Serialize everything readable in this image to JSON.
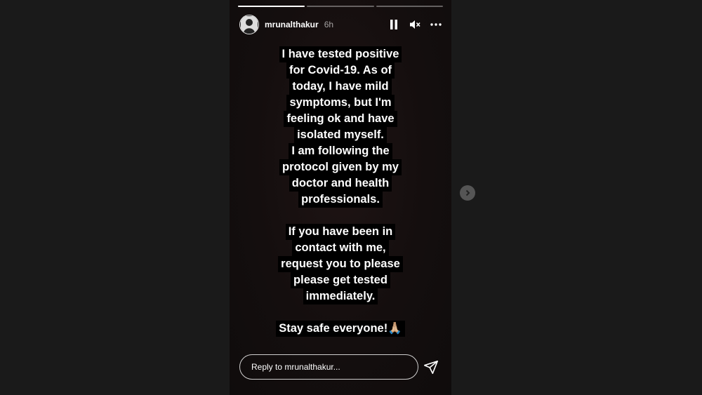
{
  "story": {
    "progress": [
      1,
      0,
      0
    ],
    "user": {
      "username": "mrunalthakur",
      "time": "6h",
      "avatar_icon": "avatar-icon"
    },
    "controls": {
      "pause_icon": "pause-icon",
      "mute_icon": "speaker-muted-icon",
      "more_icon": "more-icon"
    },
    "text_lines_block1": [
      "I have tested positive",
      "for Covid-19. As of",
      "today, I have mild",
      "symptoms, but I'm",
      "feeling ok and have",
      "isolated myself.",
      "I am following the",
      "protocol given by my",
      "doctor and health",
      "professionals."
    ],
    "text_lines_block2": [
      "If you have been in",
      "contact with me,",
      "request you to please",
      "please get tested",
      "immediately."
    ],
    "closing_line": "Stay safe everyone!🙏🏼",
    "reply": {
      "placeholder": "Reply to mrunalthakur...",
      "send_icon": "send-icon"
    }
  },
  "navigation": {
    "next_icon": "chevron-right-icon"
  },
  "colors": {
    "page_bg": "#1a1a1a",
    "story_bg": "#140e0e",
    "text": "#ffffff",
    "text_highlight": "#000000"
  }
}
